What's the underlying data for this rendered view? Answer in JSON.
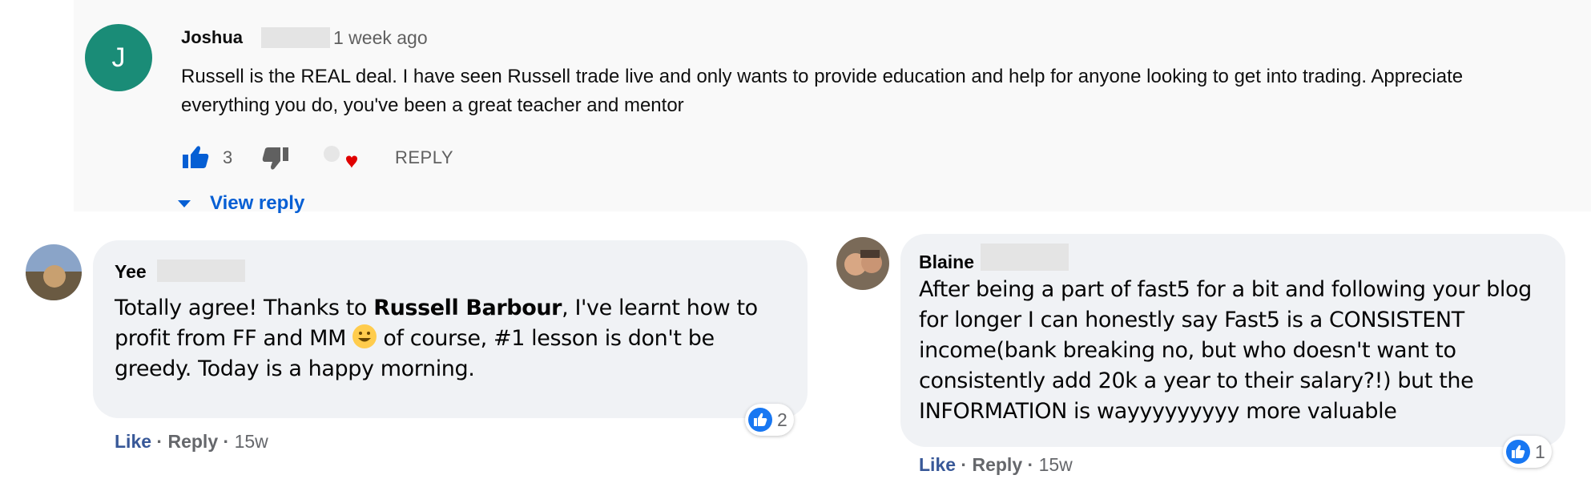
{
  "youtube_comment": {
    "avatar_letter": "J",
    "author": "Joshua",
    "time": "1 week ago",
    "text": "Russell is the REAL deal. I have seen Russell trade live and only wants to provide education and help for anyone looking to get into trading. Appreciate everything you do, you've been a great teacher and mentor",
    "like_count": "3",
    "reply_label": "REPLY",
    "view_reply_label": "View reply",
    "colors": {
      "avatar": "#1a8c77",
      "link": "#065fd4",
      "heart": "#e00000"
    }
  },
  "fb_comments": [
    {
      "name": "Yee",
      "text_before": "Totally agree! Thanks to ",
      "text_bold": "Russell Barbour",
      "text_middle": ", I've learnt how to profit from FF and MM ",
      "text_after": " of course, #1 lesson is don't be greedy. Today is a happy morning.",
      "reaction_count": "2",
      "like_label": "Like",
      "reply_label": "Reply",
      "time": "15w"
    },
    {
      "name": "Blaine",
      "text": "After being a part of fast5 for a bit and following your blog for longer I can honestly say Fast5 is a CONSISTENT income(bank breaking no, but who doesn't want to consistently add 20k a year to their salary?!) but the INFORMATION is wayyyyyyyyy more valuable",
      "reaction_count": "1",
      "like_label": "Like",
      "reply_label": "Reply",
      "time": "15w"
    }
  ],
  "separator": "·",
  "icons": [
    "thumbs-up-icon",
    "thumbs-down-icon",
    "heart-icon",
    "caret-down-icon",
    "like-reaction-icon",
    "smile-emoji-icon"
  ]
}
